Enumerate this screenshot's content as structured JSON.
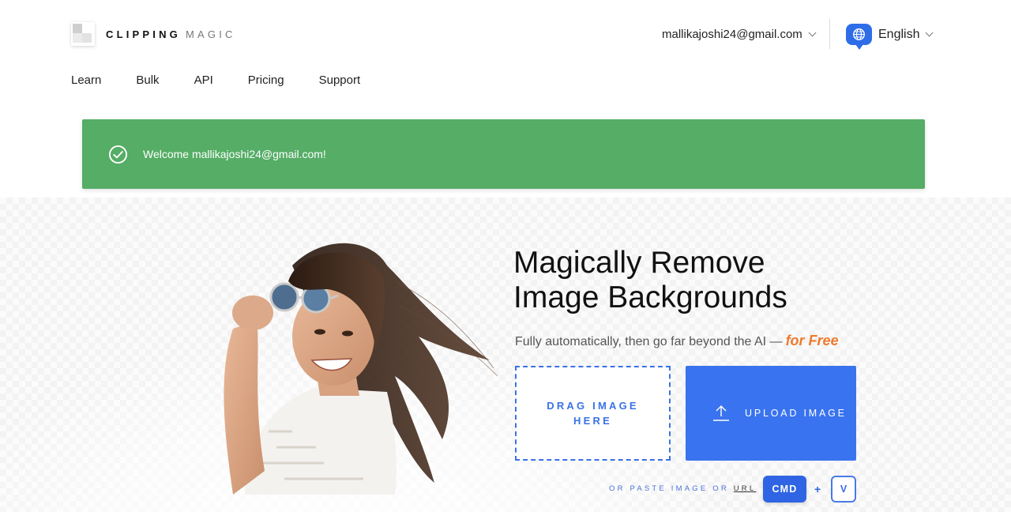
{
  "header": {
    "logo_bold": "CLIPPING",
    "logo_light": "MAGIC",
    "account_email": "mallikajoshi24@gmail.com",
    "language": "English"
  },
  "nav": {
    "items": [
      "Learn",
      "Bulk",
      "API",
      "Pricing",
      "Support"
    ]
  },
  "alert": {
    "message": "Welcome mallikajoshi24@gmail.com!",
    "color": "#55ad66"
  },
  "hero": {
    "headline_line1": "Magically Remove",
    "headline_line2": "Image Backgrounds",
    "subline": "Fully automatically, then go far beyond the AI —",
    "subline_accent": "for Free",
    "drop_label": "DRAG IMAGE\nHERE",
    "upload_label": "UPLOAD IMAGE",
    "paste_prefix": "OR PASTE IMAGE OR",
    "paste_url": "URL",
    "key_cmd": "CMD",
    "key_plus": "+",
    "key_v": "V"
  },
  "icons": {
    "alert": "check-circle-icon",
    "language": "globe-icon",
    "upload": "upload-arrow-icon"
  },
  "colors": {
    "accent_blue": "#3973ef",
    "accent_orange": "#ee7a2e",
    "success_green": "#55ad66"
  }
}
